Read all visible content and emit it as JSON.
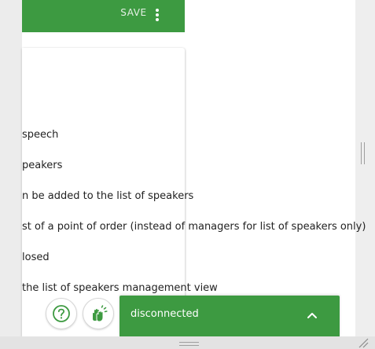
{
  "toolbar": {
    "save_label": "SAVE",
    "more_icon": "more-vert-icon"
  },
  "settings": [
    {
      "text": "speech"
    },
    {
      "text": "peakers"
    },
    {
      "text": "n be added to the list of speakers"
    },
    {
      "text": "st of a point of order (instead of managers for list of speakers only)"
    },
    {
      "text": "losed"
    },
    {
      "text": "the list of speakers management view"
    }
  ],
  "floating_buttons": {
    "help_icon": "help-circle-icon",
    "applause_icon": "applause-hands-icon"
  },
  "connection": {
    "status": "disconnected",
    "toggle_icon": "chevron-up-icon"
  },
  "colors": {
    "accent": "#3d9a41",
    "accent_text": "#ffffff"
  }
}
